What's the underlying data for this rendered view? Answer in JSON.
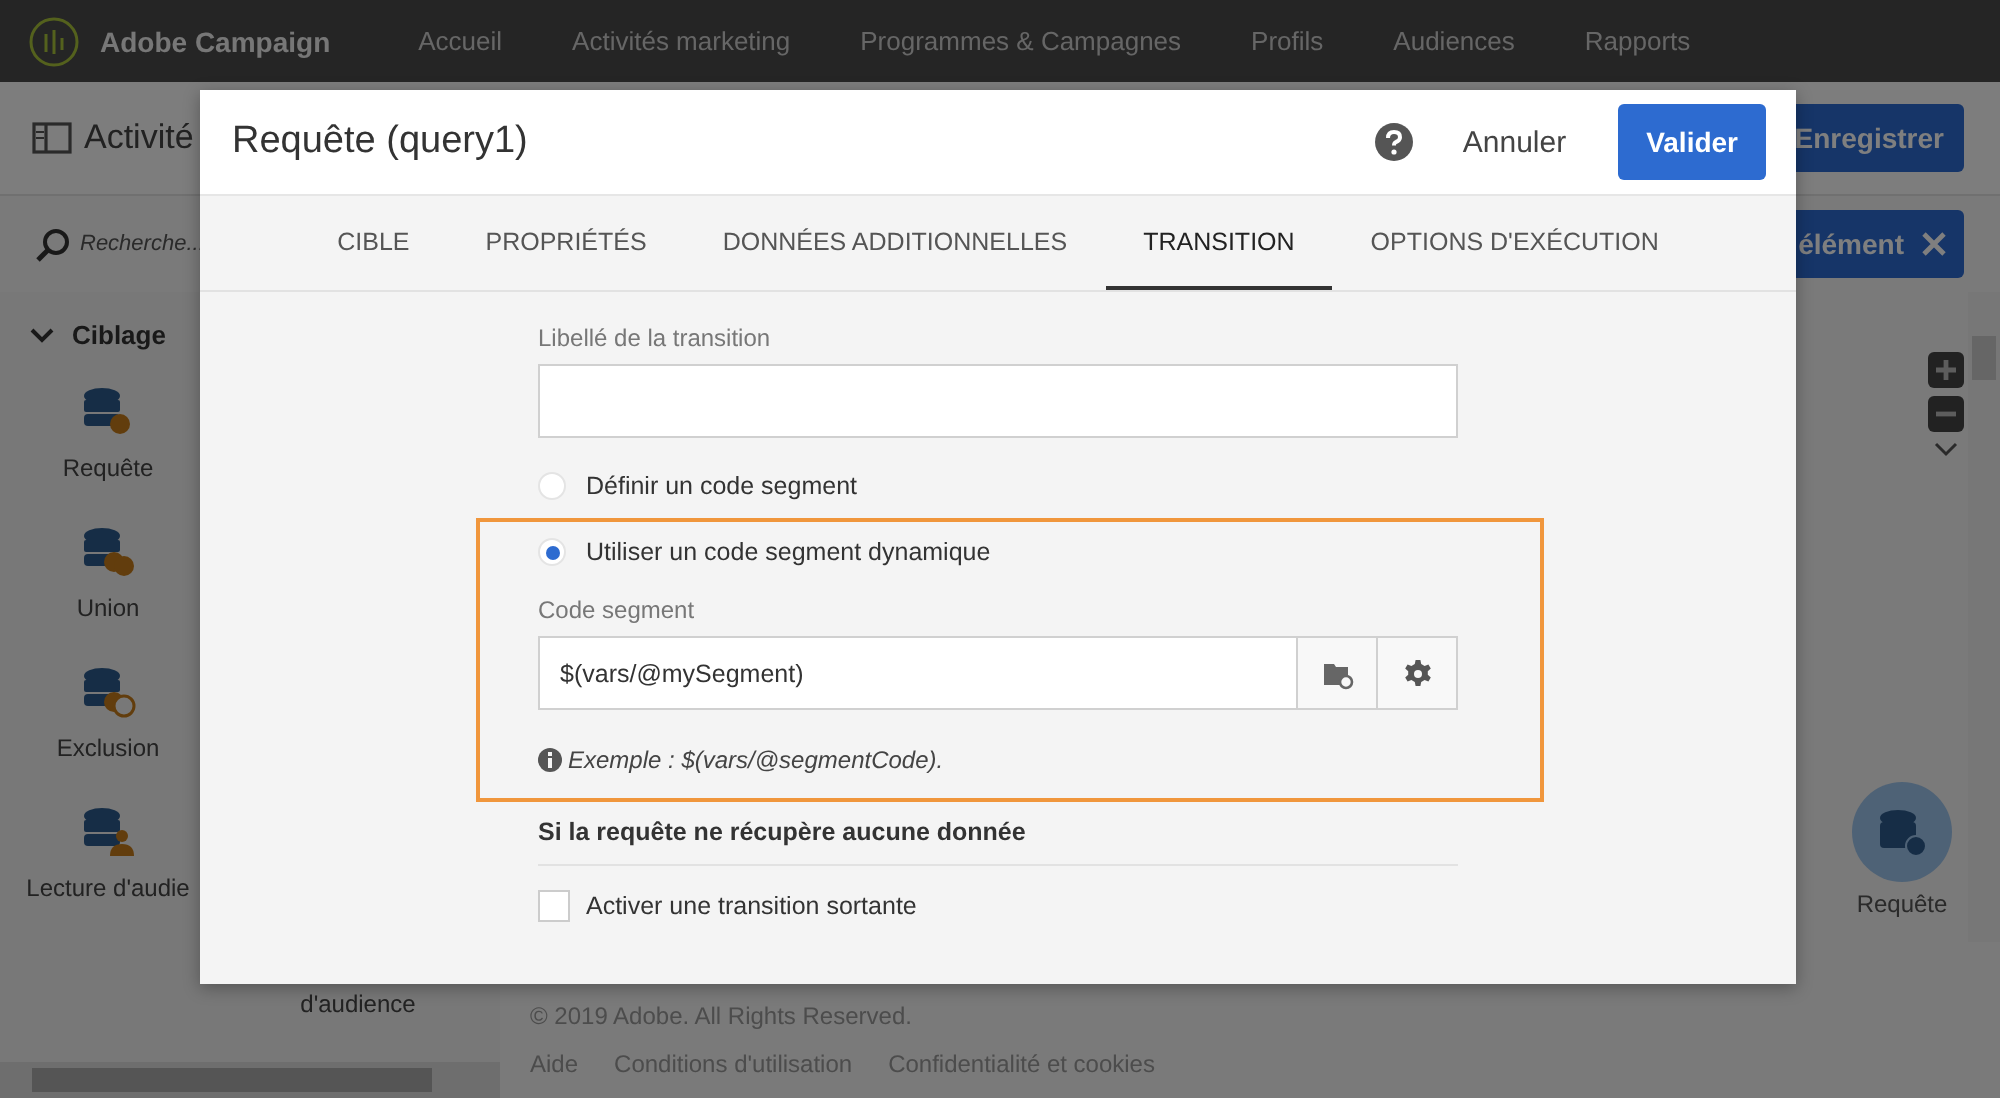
{
  "topbar": {
    "brand": "Adobe Campaign",
    "nav": [
      "Accueil",
      "Activités marketing",
      "Programmes & Campagnes",
      "Profils",
      "Audiences",
      "Rapports"
    ]
  },
  "header": {
    "title": "Activité",
    "save_button": "Enregistrer"
  },
  "toolbar": {
    "search": {
      "placeholder": "Recherche..."
    },
    "button": "élément"
  },
  "sidebar": {
    "section": {
      "label": "Ciblage",
      "expanded": true
    },
    "items": [
      {
        "label": "Requête",
        "kind": "query"
      },
      {
        "label": "Union",
        "kind": "union"
      },
      {
        "label": "Exclusion",
        "kind": "exclusion"
      },
      {
        "label": "Lecture d'audie",
        "kind": "audience"
      }
    ],
    "column_2_label": "d'audience"
  },
  "canvas": {
    "node": {
      "label": "Requête"
    }
  },
  "footer": {
    "copyright": "© 2019 Adobe. All Rights Reserved.",
    "links": [
      "Aide",
      "Conditions d'utilisation",
      "Confidentialité et cookies"
    ]
  },
  "dialog": {
    "title": "Requête (query1)",
    "cancel": "Annuler",
    "validate": "Valider",
    "tabs": [
      {
        "label": "CIBLE",
        "selected": false
      },
      {
        "label": "PROPRIÉTÉS",
        "selected": false
      },
      {
        "label": "DONNÉES ADDITIONNELLES",
        "selected": false
      },
      {
        "label": "TRANSITION",
        "selected": true
      },
      {
        "label": "OPTIONS D'EXÉCUTION",
        "selected": false
      }
    ],
    "transition_label": "Libellé de la transition",
    "options": [
      {
        "label": "Définir un code segment",
        "selected": false
      },
      {
        "label": "Utiliser un code segment dynamique",
        "selected": true
      }
    ],
    "code_label": "Code segment",
    "code_value": "$(vars/@mySegment)",
    "hint": "Exemple : $(vars/@segmentCode).",
    "section_title": "Si la requête ne récupère aucune donnée",
    "checkbox": {
      "label": "Activer une transition sortante",
      "checked": false
    }
  }
}
